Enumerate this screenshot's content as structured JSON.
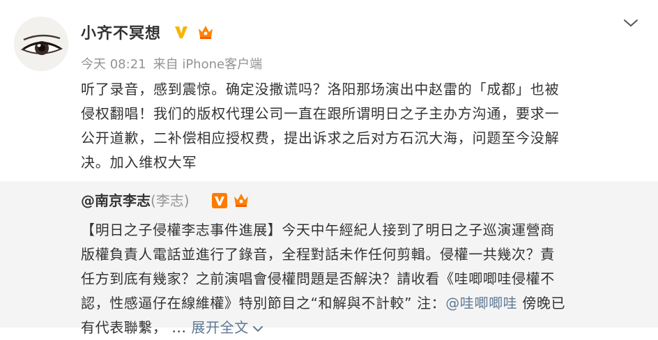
{
  "post": {
    "username": "小齐不冥想",
    "time": "今天 08:21",
    "source": "来自 iPhone客户端",
    "content_lines": [
      "听了录音，感到震惊。确定没撒谎吗？洛阳那场演出中赵雷的「成都」也被",
      "侵权翻唱！我们的版权代理公司一直在跟所谓明日之子主办方沟通，要求一",
      "公开道歉，二补偿相应授权费，提出诉求之后对方石沉大海，问题至今没解",
      "决。加入维权大军"
    ],
    "icons": {
      "verified": "verified-v-icon",
      "member": "member-crown-icon",
      "menu": "chevron-down-icon"
    }
  },
  "repost": {
    "author": "@南京李志",
    "alias": "(李志)",
    "lines": [
      "【明日之子侵權李志事件進展】今天中午經紀人接到了明日之子巡演運營商",
      "版權負責人電話並進行了錄音，全程對話未作任何剪輯。侵權一共幾次？責",
      "任方到底有幾家？之前演唱會侵權問題是否解決？請收看《哇唧唧哇侵權不",
      "認，性感逼仔在線維權》特別節目之“和解與不計較” 注："
    ],
    "mention": "@哇唧唧哇",
    "line4_tail": " 傍晚已",
    "line5_prefix": "有代表聯繫，  ... ",
    "expand_label": "展开全文",
    "colors": {
      "background": "#f4f4f4",
      "link": "#5d7895",
      "muted": "#939393",
      "gold": "#f7b500",
      "orange": "#ff8200"
    }
  }
}
